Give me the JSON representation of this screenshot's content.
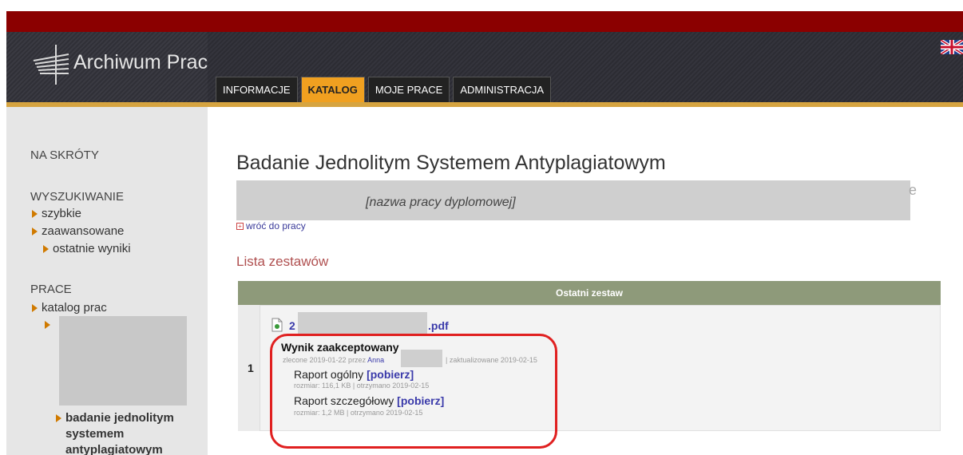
{
  "header": {
    "logo_text": "Archiwum Prac",
    "tabs": [
      {
        "label": "INFORMACJE",
        "active": false
      },
      {
        "label": "KATALOG",
        "active": true
      },
      {
        "label": "MOJE PRACE",
        "active": false
      },
      {
        "label": "ADMINISTRACJA",
        "active": false
      }
    ],
    "language_icon": "uk-flag-icon"
  },
  "sidebar": {
    "shortcuts_title": "NA SKRÓTY",
    "search_title": "WYSZUKIWANIE",
    "search_items": [
      "szybkie",
      "zaawansowane",
      "ostatnie wyniki"
    ],
    "works_title": "PRACE",
    "works_items": [
      "katalog prac"
    ],
    "active_item_lines": [
      "badanie jednolitym",
      "systemem",
      "antyplagiatowym"
    ]
  },
  "main": {
    "page_title": "Badanie Jednolitym Systemem Antyplagiatowym",
    "thesis_placeholder": "[nazwa pracy dyplomowej]",
    "edge_letter": "e",
    "back_link": "wróć do pracy",
    "section_title": "Lista zestawów",
    "table": {
      "header": "Ostatni zestaw",
      "row_number": "1",
      "file_prefix": "2",
      "file_suffix": ".pdf",
      "result_title": "Wynik zaakceptowany",
      "ordered_text": "zlecone 2019-01-22 przez",
      "ordered_by": "Anna",
      "updated_text": "| zaktualizowane 2019-02-15",
      "reports": [
        {
          "name": "Raport ogólny",
          "download": "[pobierz]",
          "meta": "rozmiar: 116,1 KB | otrzymano 2019-02-15"
        },
        {
          "name": "Raport szczegółowy",
          "download": "[pobierz]",
          "meta": "rozmiar: 1,2 MB | otrzymano 2019-02-15"
        }
      ]
    }
  },
  "colors": {
    "top_red": "#8b0000",
    "gold": "#d6a440",
    "tab_active": "#f0a020",
    "table_header": "#8e9a7a",
    "highlight": "#e02020"
  }
}
